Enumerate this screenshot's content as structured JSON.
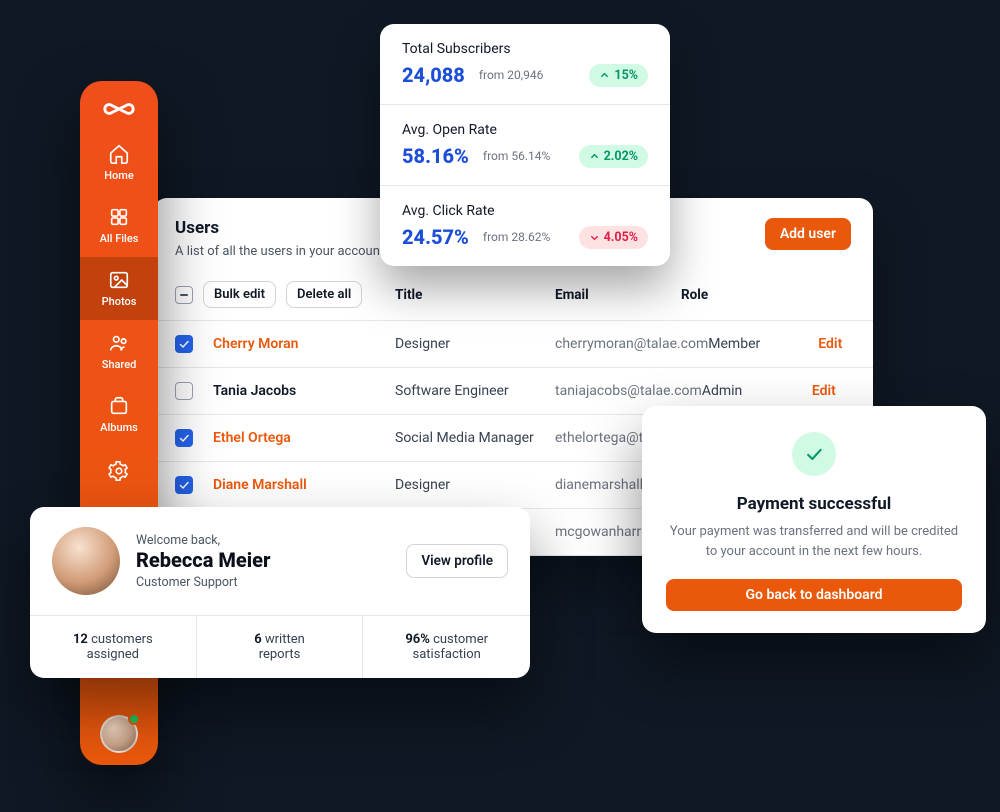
{
  "sidebar": {
    "items": [
      {
        "id": "home",
        "label": "Home"
      },
      {
        "id": "all-files",
        "label": "All Files"
      },
      {
        "id": "photos",
        "label": "Photos",
        "active": true
      },
      {
        "id": "shared",
        "label": "Shared"
      },
      {
        "id": "albums",
        "label": "Albums"
      },
      {
        "id": "settings",
        "label": ""
      }
    ]
  },
  "users": {
    "title": "Users",
    "subtitle": "A list of all the users in your account",
    "add_label": "Add user",
    "bulk_edit_label": "Bulk edit",
    "delete_all_label": "Delete all",
    "columns": {
      "title": "Title",
      "email": "Email",
      "role": "Role"
    },
    "edit_label": "Edit",
    "rows": [
      {
        "selected": true,
        "name": "Cherry Moran",
        "title": "Designer",
        "email": "cherrymoran@talae.com",
        "role": "Member"
      },
      {
        "selected": false,
        "name": "Tania Jacobs",
        "title": "Software Engineer",
        "email": "taniajacobs@talae.com",
        "role": "Admin"
      },
      {
        "selected": true,
        "name": "Ethel Ortega",
        "title": "Social Media Manager",
        "email": "ethelortega@talae.com",
        "role": ""
      },
      {
        "selected": true,
        "name": "Diane Marshall",
        "title": "Designer",
        "email": "dianemarshall@talae.com",
        "role": ""
      },
      {
        "selected": false,
        "name": "",
        "title": "",
        "email": "mcgowanharrington@talae.com",
        "role": ""
      }
    ]
  },
  "stats": [
    {
      "label": "Total Subscribers",
      "value": "24,088",
      "from": "from 20,946",
      "delta": "15%",
      "dir": "up"
    },
    {
      "label": "Avg. Open Rate",
      "value": "58.16%",
      "from": "from 56.14%",
      "delta": "2.02%",
      "dir": "up"
    },
    {
      "label": "Avg. Click Rate",
      "value": "24.57%",
      "from": "from 28.62%",
      "delta": "4.05%",
      "dir": "down"
    }
  ],
  "payment": {
    "title": "Payment successful",
    "body": "Your payment was transferred and will be credited to your account in the next few hours.",
    "cta": "Go back to dashboard"
  },
  "profile": {
    "welcome": "Welcome back,",
    "name": "Rebecca Meier",
    "role": "Customer Support",
    "view_label": "View profile",
    "stats": [
      {
        "value": "12",
        "label": "customers assigned"
      },
      {
        "value": "6",
        "label": "written reports"
      },
      {
        "value": "96%",
        "label": "customer satisfaction"
      }
    ]
  }
}
